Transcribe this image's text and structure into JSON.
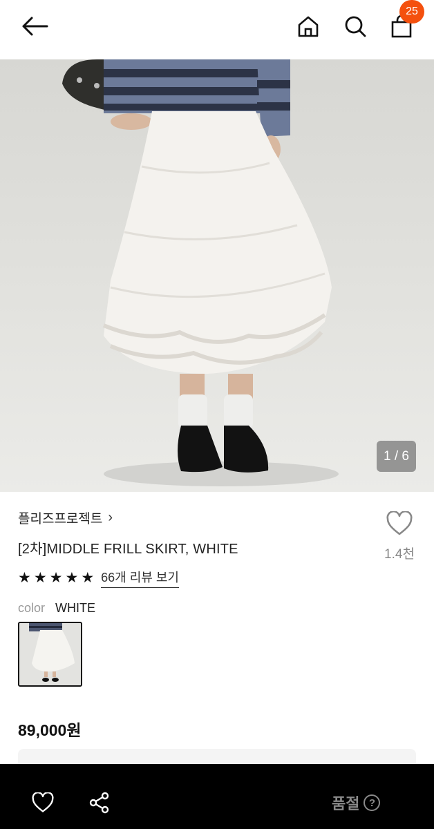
{
  "header": {
    "back_icon": "arrow-left-icon",
    "home_icon": "home-icon",
    "search_icon": "search-icon",
    "bag_icon": "shopping-bag-icon",
    "cart_count": "25",
    "badge_color": "#f4500e"
  },
  "gallery": {
    "counter": "1 / 6"
  },
  "product": {
    "brand": "플리즈프로젝트",
    "brand_chevron": "›",
    "title": "[2차]MIDDLE FRILL SKIRT, WHITE",
    "like_count": "1.4천",
    "rating_stars": 5,
    "review_link": "66개 리뷰 보기",
    "color_label": "color",
    "color_value": "WHITE",
    "price": "89,000원"
  },
  "bottom_bar": {
    "heart_icon": "heart-outline-icon",
    "share_icon": "share-icon",
    "status": "품절",
    "help": "?"
  }
}
